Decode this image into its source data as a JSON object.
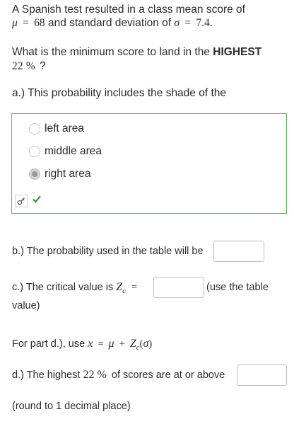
{
  "question": {
    "intro_line1": "A Spanish test resulted in a class mean score of",
    "mu_symbol": "μ",
    "equals": "=",
    "mean_value": "68",
    "and_sd_text": "and standard deviation of",
    "sigma_symbol": "σ",
    "sd_value": "7.4.",
    "ask_prefix": "What is the minimum score to land in the",
    "ask_bold": "HIGHEST",
    "percent_value": "22",
    "percent_sign": "%",
    "question_mark": "?"
  },
  "part_a": {
    "prompt": "a.) This probability includes the shade of the",
    "options": [
      {
        "label": "left area",
        "selected": false
      },
      {
        "label": "middle area",
        "selected": false
      },
      {
        "label": "right area",
        "selected": true
      }
    ],
    "status": "correct"
  },
  "part_b": {
    "prompt": "b.) The probability used in the table will be",
    "input_value": ""
  },
  "part_c": {
    "prompt": "c.) The critical value is",
    "z_symbol": "Z",
    "z_subscript": "c",
    "equals": "=",
    "input_value": "",
    "suffix": "(use the table",
    "suffix_line2": "value)"
  },
  "formula": {
    "prefix": "For part d.), use",
    "x_symbol": "x",
    "equals": "=",
    "mu_symbol": "μ",
    "plus": "+",
    "z_symbol": "Z",
    "z_subscript": "c",
    "open_paren": "(",
    "sigma_symbol": "σ",
    "close_paren": ")"
  },
  "part_d": {
    "prompt": "d.) The highest",
    "percent_value": "22",
    "percent_sign": "%",
    "suffix": "of scores are at or above",
    "input_value": "",
    "note": "(round to 1 decimal place)"
  },
  "colors": {
    "correct_border": "#5cb85c",
    "check_mark": "#2e8b2e",
    "input_border": "#bdbdbd"
  },
  "icons": {
    "key": "key-icon",
    "check": "check-icon"
  }
}
